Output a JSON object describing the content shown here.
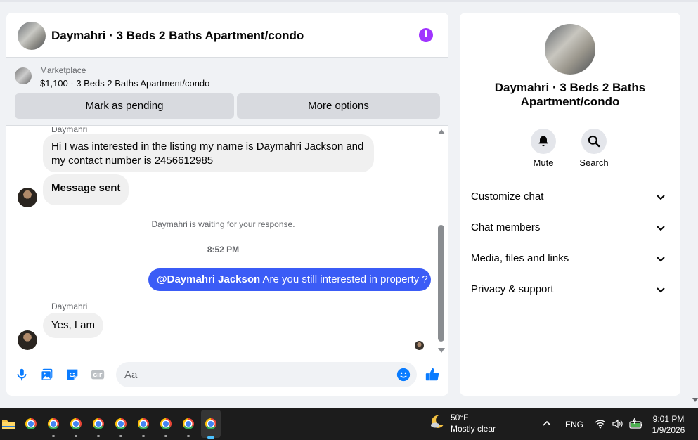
{
  "chat": {
    "title": "Daymahri · 3 Beds 2 Baths Apartment/condo",
    "marketplace": {
      "label": "Marketplace",
      "listing": "$1,100 - 3 Beds 2 Baths Apartment/condo",
      "mark_pending": "Mark as pending",
      "more_options": "More options"
    },
    "messages": {
      "sender_top": "Daymahri",
      "first": "Hi I was interested in the listing my name is Daymahri Jackson and my contact number is 2456612985",
      "second": "Message sent",
      "waiting": "Daymahri is waiting for your response.",
      "timestamp": "8:52 PM",
      "outgoing_mention": "@Daymahri Jackson",
      "outgoing_text": " Are you still interested in property ?",
      "sender_bottom": "Daymahri",
      "reply": "Yes, I am"
    },
    "composer": {
      "placeholder": "Aa"
    }
  },
  "side": {
    "name": "Daymahri · 3 Beds 2 Baths Apartment/condo",
    "mute": "Mute",
    "search": "Search",
    "rows": [
      "Customize chat",
      "Chat members",
      "Media, files and links",
      "Privacy & support"
    ]
  },
  "taskbar": {
    "temperature": "50°F",
    "condition": "Mostly clear",
    "language": "ENG",
    "time": "9:01 PM",
    "date": "1/9/2026"
  },
  "colors": {
    "accent_blue": "#3b5cf6",
    "info_purple": "#a033ff",
    "composer_icon_blue": "#0a7cff"
  }
}
